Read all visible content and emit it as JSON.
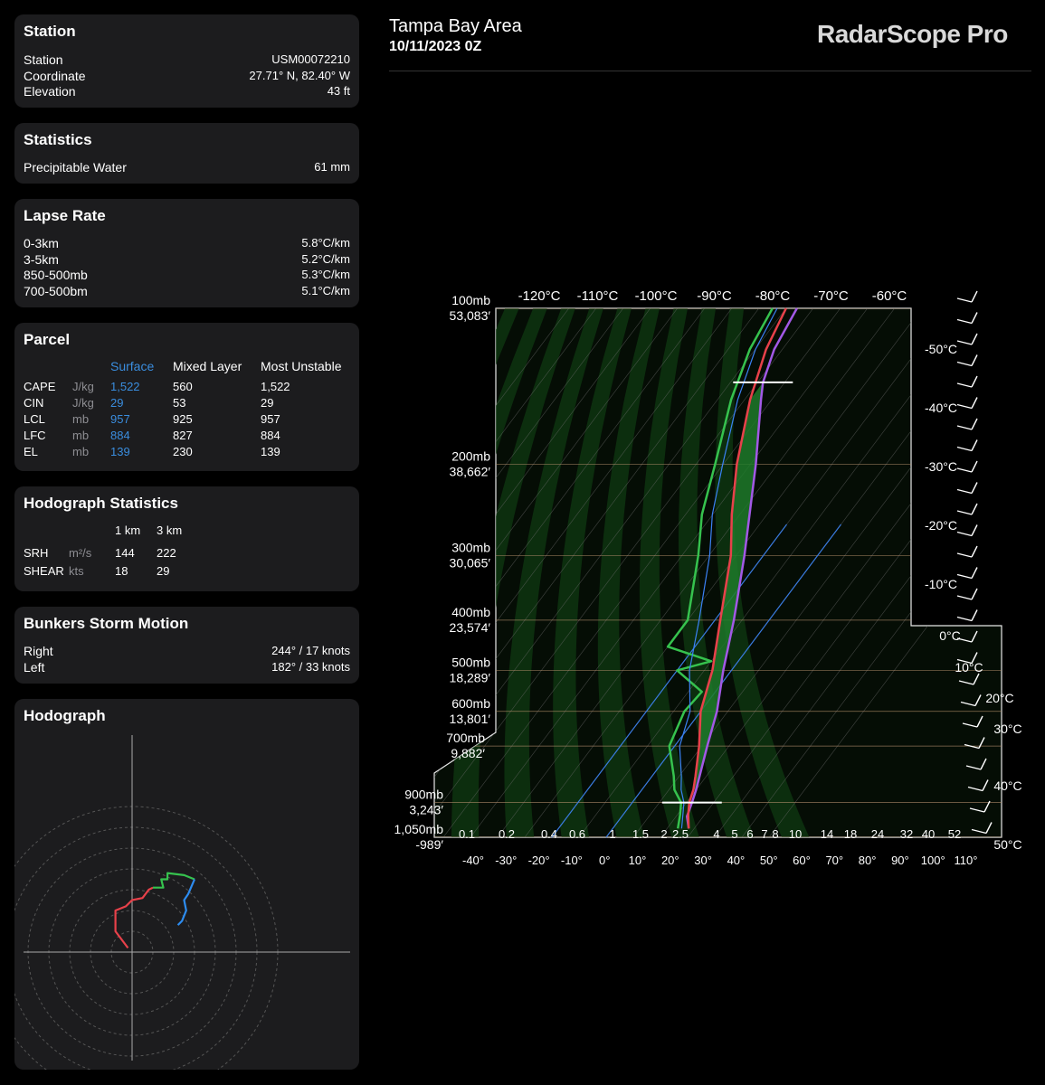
{
  "header": {
    "location": "Tampa Bay Area",
    "datetime": "10/11/2023 0Z",
    "brand": "RadarScope Pro"
  },
  "station": {
    "title": "Station",
    "rows": [
      {
        "label": "Station",
        "value": "USM00072210"
      },
      {
        "label": "Coordinate",
        "value": "27.71° N, 82.40° W"
      },
      {
        "label": "Elevation",
        "value": "43 ft"
      }
    ]
  },
  "statistics": {
    "title": "Statistics",
    "rows": [
      {
        "label": "Precipitable Water",
        "value": "61 mm"
      }
    ]
  },
  "lapse": {
    "title": "Lapse Rate",
    "rows": [
      {
        "label": "0-3km",
        "value": "5.8°C/km"
      },
      {
        "label": "3-5km",
        "value": "5.2°C/km"
      },
      {
        "label": "850-500mb",
        "value": "5.3°C/km"
      },
      {
        "label": "700-500bm",
        "value": "5.1°C/km"
      }
    ]
  },
  "parcel": {
    "title": "Parcel",
    "columns": [
      "Surface",
      "Mixed Layer",
      "Most Unstable"
    ],
    "rows": [
      {
        "label": "CAPE",
        "unit": "J/kg",
        "values": [
          "1,522",
          "560",
          "1,522"
        ]
      },
      {
        "label": "CIN",
        "unit": "J/kg",
        "values": [
          "29",
          "53",
          "29"
        ]
      },
      {
        "label": "LCL",
        "unit": "mb",
        "values": [
          "957",
          "925",
          "957"
        ]
      },
      {
        "label": "LFC",
        "unit": "mb",
        "values": [
          "884",
          "827",
          "884"
        ]
      },
      {
        "label": "EL",
        "unit": "mb",
        "values": [
          "139",
          "230",
          "139"
        ]
      }
    ]
  },
  "hodostats": {
    "title": "Hodograph Statistics",
    "columns": [
      "1 km",
      "3 km"
    ],
    "rows": [
      {
        "label": "SRH",
        "unit": "m²/s",
        "values": [
          "144",
          "222"
        ]
      },
      {
        "label": "SHEAR",
        "unit": "kts",
        "values": [
          "18",
          "29"
        ]
      }
    ]
  },
  "bunkers": {
    "title": "Bunkers Storm Motion",
    "rows": [
      {
        "label": "Right",
        "value": "244° / 17 knots"
      },
      {
        "label": "Left",
        "value": "182° / 33 knots"
      }
    ]
  },
  "hodograph_title": "Hodograph",
  "colors": {
    "temperature": "#e8414a",
    "dewpoint": "#36c24e",
    "parcel": "#a259e6",
    "wetbulb": "#3b82f6",
    "cape_fill": "#1f7a2a",
    "hodo_red": "#e8414a",
    "hodo_green": "#36c24e",
    "hodo_blue": "#2d8cf0"
  },
  "chart_data": [
    {
      "type": "line",
      "chart": "skew-t",
      "pressure_labels": [
        {
          "p": 100,
          "label": "100mb",
          "height": "53,083′"
        },
        {
          "p": 200,
          "label": "200mb",
          "height": "38,662′"
        },
        {
          "p": 300,
          "label": "300mb",
          "height": "30,065′"
        },
        {
          "p": 400,
          "label": "400mb",
          "height": "23,574′"
        },
        {
          "p": 500,
          "label": "500mb",
          "height": "18,289′"
        },
        {
          "p": 600,
          "label": "600mb",
          "height": "13,801′"
        },
        {
          "p": 700,
          "label": "700mb",
          "height": "9,882′"
        },
        {
          "p": 900,
          "label": "900mb",
          "height": "3,243′"
        },
        {
          "p": 1050,
          "label": "1,050mb",
          "height": "-989′"
        }
      ],
      "top_temp_labels": [
        "-120°C",
        "-110°C",
        "-100°C",
        "-90°C",
        "-80°C",
        "-70°C",
        "-60°C"
      ],
      "right_temp_labels": [
        "-50°C",
        "-40°C",
        "-30°C",
        "-20°C",
        "-10°C",
        "0°C",
        "10°C",
        "20°C",
        "30°C",
        "40°C",
        "50°C"
      ],
      "bottom_f_labels": [
        "-40°",
        "-30°",
        "-20°",
        "-10°",
        "0°",
        "10°",
        "20°",
        "30°",
        "40°",
        "50°",
        "60°",
        "70°",
        "80°",
        "90°",
        "100°",
        "110°"
      ],
      "mixing_ratio_labels": [
        "0.1",
        "0.2",
        "0.4",
        "0.6",
        "1",
        "1.5",
        "2",
        "2.5",
        "4",
        "5",
        "6",
        "7",
        "8",
        "10",
        "14",
        "18",
        "24",
        "32",
        "40",
        "52"
      ],
      "series": [
        {
          "name": "temperature",
          "points": [
            [
              1010,
              28
            ],
            [
              950,
              24
            ],
            [
              900,
              21
            ],
            [
              850,
              19
            ],
            [
              800,
              16
            ],
            [
              700,
              9
            ],
            [
              600,
              0
            ],
            [
              500,
              -7
            ],
            [
              400,
              -18
            ],
            [
              300,
              -32
            ],
            [
              250,
              -43
            ],
            [
              200,
              -55
            ],
            [
              150,
              -68
            ],
            [
              120,
              -76
            ],
            [
              100,
              -80
            ]
          ]
        },
        {
          "name": "dewpoint",
          "points": [
            [
              1010,
              24
            ],
            [
              950,
              21
            ],
            [
              900,
              18
            ],
            [
              850,
              12
            ],
            [
              800,
              8
            ],
            [
              700,
              -2
            ],
            [
              600,
              -6
            ],
            [
              550,
              -5
            ],
            [
              500,
              -20
            ],
            [
              480,
              -10
            ],
            [
              450,
              -30
            ],
            [
              400,
              -30
            ],
            [
              300,
              -44
            ],
            [
              250,
              -54
            ],
            [
              200,
              -63
            ],
            [
              150,
              -75
            ],
            [
              120,
              -82
            ],
            [
              100,
              -85
            ]
          ]
        },
        {
          "name": "parcel",
          "points": [
            [
              1010,
              28
            ],
            [
              957,
              24
            ],
            [
              900,
              22
            ],
            [
              850,
              20
            ],
            [
              700,
              12
            ],
            [
              600,
              6
            ],
            [
              500,
              -3
            ],
            [
              400,
              -13
            ],
            [
              300,
              -27
            ],
            [
              200,
              -48
            ],
            [
              150,
              -64
            ],
            [
              139,
              -68
            ],
            [
              120,
              -73
            ],
            [
              100,
              -76
            ]
          ]
        }
      ]
    },
    {
      "type": "line",
      "chart": "hodograph",
      "rings_knots": [
        10,
        20,
        30,
        40,
        50,
        60,
        70
      ],
      "series": [
        {
          "name": "0-3 km",
          "points": [
            [
              -2,
              2
            ],
            [
              -8,
              10
            ],
            [
              -8,
              20
            ],
            [
              -3,
              22
            ],
            [
              0,
              25
            ],
            [
              5,
              26
            ],
            [
              8,
              30
            ],
            [
              10,
              31
            ]
          ]
        },
        {
          "name": "3-6 km",
          "points": [
            [
              10,
              31
            ],
            [
              15,
              31
            ],
            [
              14,
              35
            ],
            [
              17,
              35
            ],
            [
              17,
              38
            ],
            [
              25,
              37
            ],
            [
              30,
              35
            ]
          ]
        },
        {
          "name": "6-10 km",
          "points": [
            [
              30,
              35
            ],
            [
              27,
              28
            ],
            [
              25,
              25
            ],
            [
              26,
              20
            ],
            [
              24,
              15
            ],
            [
              22,
              13
            ]
          ]
        }
      ]
    }
  ]
}
